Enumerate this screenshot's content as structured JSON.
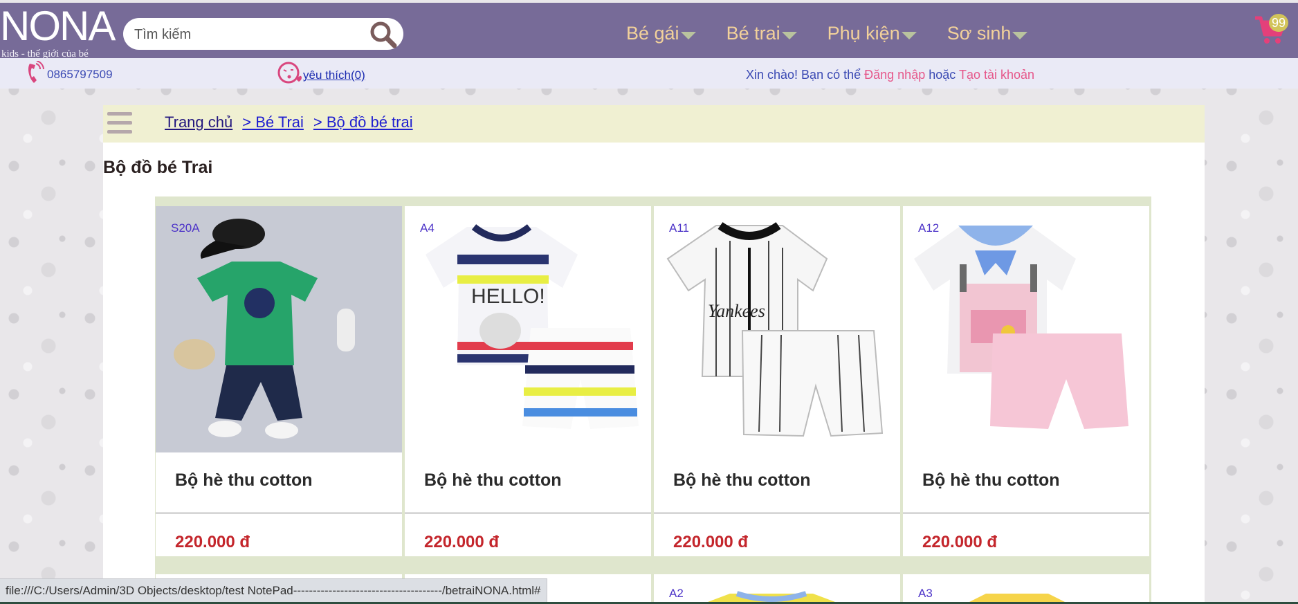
{
  "brand": {
    "name": "NONA",
    "tagline": "kids - thế giới của bé"
  },
  "search": {
    "placeholder": "Tìm kiếm"
  },
  "nav": [
    {
      "label": "Bé gái"
    },
    {
      "label": "Bé trai"
    },
    {
      "label": "Phụ kiện"
    },
    {
      "label": "Sơ sinh"
    }
  ],
  "cart": {
    "count": "99"
  },
  "contact": {
    "phone": "0865797509",
    "favorites": "yêu thích(0)"
  },
  "account": {
    "greeting": "Xin chào! Bạn có thể",
    "login": "Đăng nhập",
    "or": "hoặc",
    "register": "Tạo tài khoản"
  },
  "breadcrumb": [
    "Trang chủ",
    "> Bé Trai",
    "> Bộ đồ bé trai"
  ],
  "category_title": "Bộ đồ bé Trai",
  "products": [
    {
      "code": "S20A",
      "name": "Bộ hè thu cotton",
      "price": "220.000 đ"
    },
    {
      "code": "A4",
      "name": "Bộ hè thu cotton",
      "price": "220.000 đ"
    },
    {
      "code": "A11",
      "name": "Bộ hè thu cotton",
      "price": "220.000 đ"
    },
    {
      "code": "A12",
      "name": "Bộ hè thu cotton",
      "price": "220.000 đ"
    }
  ],
  "products_row2": [
    {
      "code": ""
    },
    {
      "code": ""
    },
    {
      "code": "A2"
    },
    {
      "code": "A3"
    }
  ],
  "status_url": "file:///C:/Users/Admin/3D Objects/desktop/test NotePad--------------------------------------/betraiNONA.html#",
  "colors": {
    "header": "#776b98",
    "nav_text": "#f2d19a",
    "price": "#c4262c",
    "accent_pink": "#e6578a"
  }
}
